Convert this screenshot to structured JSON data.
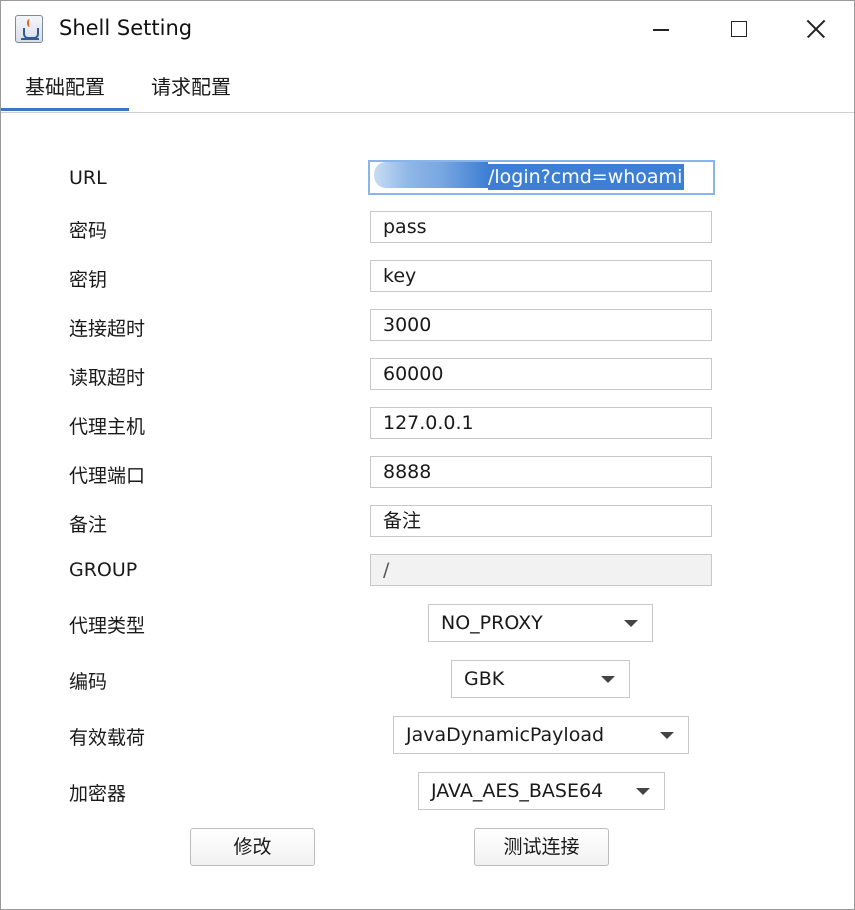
{
  "window": {
    "title": "Shell Setting",
    "app_icon": "java-cup-icon"
  },
  "tabs": [
    {
      "label": "基础配置",
      "active": true
    },
    {
      "label": "请求配置",
      "active": false
    }
  ],
  "form": {
    "url": {
      "label": "URL",
      "value_visible": "/login?cmd=whoami",
      "selected": true
    },
    "password": {
      "label": "密码",
      "value": "pass"
    },
    "key": {
      "label": "密钥",
      "value": "key"
    },
    "connect_timeout": {
      "label": "连接超时",
      "value": "3000"
    },
    "read_timeout": {
      "label": "读取超时",
      "value": "60000"
    },
    "proxy_host": {
      "label": "代理主机",
      "value": "127.0.0.1"
    },
    "proxy_port": {
      "label": "代理端口",
      "value": "8888"
    },
    "remark": {
      "label": "备注",
      "value": "备注"
    },
    "group": {
      "label": "GROUP",
      "value": "/",
      "disabled": true
    },
    "proxy_type": {
      "label": "代理类型",
      "selected": "NO_PROXY"
    },
    "encoding": {
      "label": "编码",
      "selected": "GBK"
    },
    "payload": {
      "label": "有效载荷",
      "selected": "JavaDynamicPayload"
    },
    "cryption": {
      "label": "加密器",
      "selected": "JAVA_AES_BASE64"
    }
  },
  "buttons": {
    "modify": "修改",
    "test_connection": "测试连接"
  },
  "colors": {
    "tab_indicator": "#3d74c6",
    "selection": "#3d7fd4",
    "focus_border": "#8ab4ec"
  }
}
